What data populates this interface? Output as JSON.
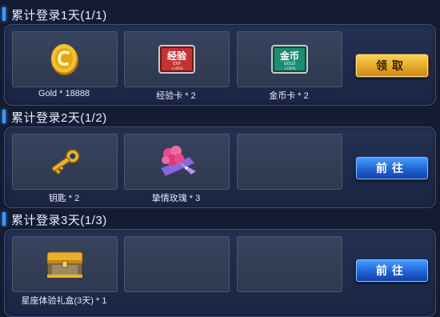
{
  "sections": [
    {
      "title": "累计登录1天(1/1)",
      "items": [
        {
          "label": "Gold * 18888",
          "icon": "gold-coin"
        },
        {
          "label": "经验卡 * 2",
          "icon": "exp-card",
          "card_text": "经验",
          "card_sub": "EXP",
          "card_pct": "+100%"
        },
        {
          "label": "金币卡 * 2",
          "icon": "gold-card",
          "card_text": "金币",
          "card_sub": "GOLD",
          "card_pct": "+100%"
        }
      ],
      "button": {
        "label": "领取",
        "style": "gold"
      }
    },
    {
      "title": "累计登录2天(1/2)",
      "items": [
        {
          "label": "钥匙 * 2",
          "icon": "key"
        },
        {
          "label": "挚情玫瑰 * 3",
          "icon": "rose-bouquet"
        },
        {
          "label": "",
          "icon": ""
        }
      ],
      "button": {
        "label": "前往",
        "style": "blue"
      }
    },
    {
      "title": "累计登录3天(1/3)",
      "items": [
        {
          "label": "星座体验礼盒(3天) * 1",
          "icon": "treasure-chest"
        },
        {
          "label": "",
          "icon": ""
        },
        {
          "label": "",
          "icon": ""
        }
      ],
      "button": {
        "label": "前往",
        "style": "blue"
      }
    }
  ],
  "colors": {
    "background": "#141c33",
    "accent_bar": "#3a9bff",
    "claim_button": "#e5a824",
    "goto_button": "#1f63d6"
  }
}
